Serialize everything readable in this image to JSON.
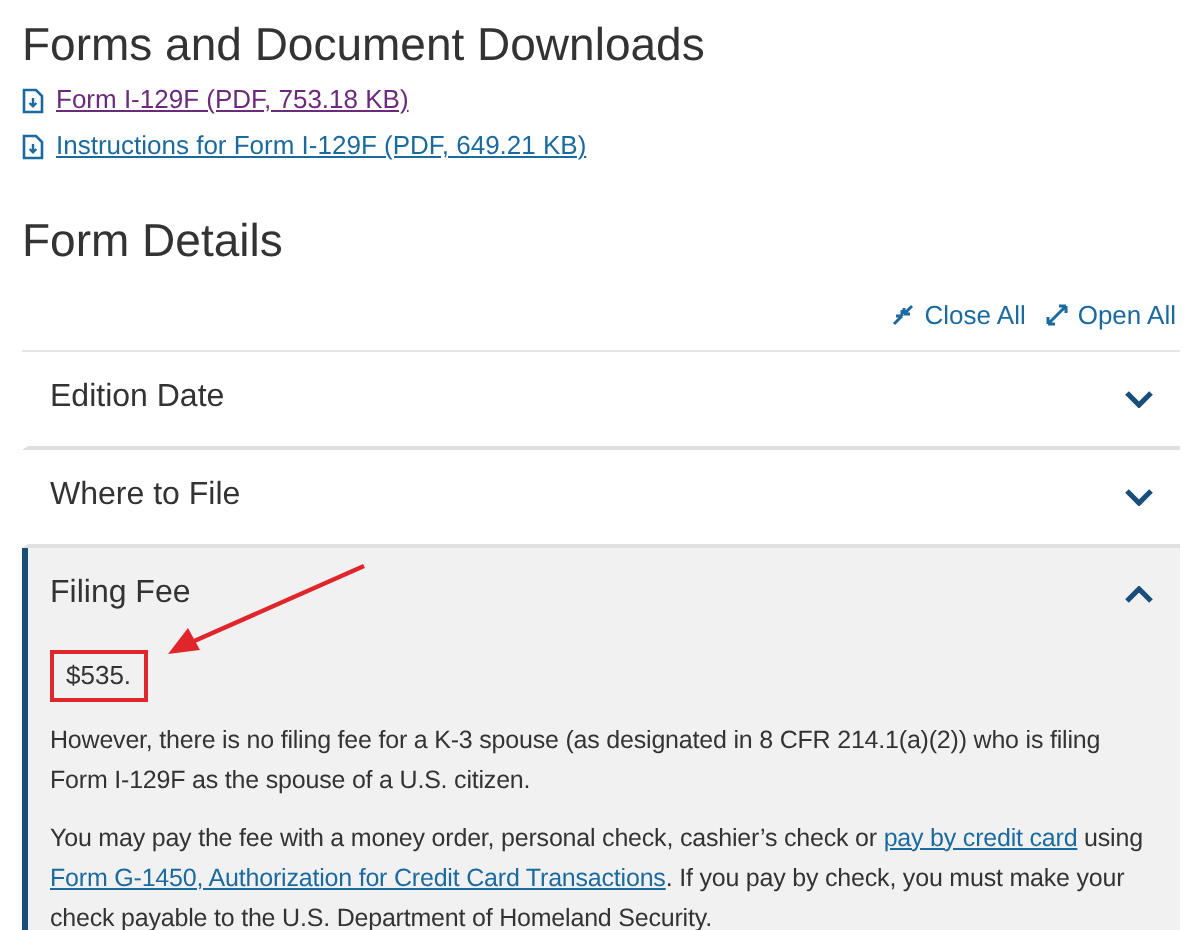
{
  "downloads": {
    "heading": "Forms and Document Downloads",
    "links": [
      {
        "label": "Form I-129F (PDF, 753.18 KB)",
        "visited": true
      },
      {
        "label": "Instructions for Form I-129F (PDF, 649.21 KB)",
        "visited": false
      }
    ]
  },
  "details": {
    "heading": "Form Details",
    "close_all": "Close All",
    "open_all": "Open All",
    "sections": [
      {
        "title": "Edition Date",
        "expanded": false
      },
      {
        "title": "Where to File",
        "expanded": false
      },
      {
        "title": "Filing Fee",
        "expanded": true,
        "fee": "$535.",
        "paragraphs": [
          [
            {
              "kind": "text",
              "text": "However, there is no filing fee for a K-3 spouse (as designated in 8 CFR 214.1(a)(2)) who is filing Form I-129F as the spouse of a U.S. citizen."
            }
          ],
          [
            {
              "kind": "text",
              "text": "You may pay the fee with a money order, personal check, cashier’s check or "
            },
            {
              "kind": "link",
              "text": "pay by credit card"
            },
            {
              "kind": "text",
              "text": " using "
            },
            {
              "kind": "link",
              "text": "Form G-1450, Authorization for Credit Card Transactions"
            },
            {
              "kind": "text",
              "text": ". If you pay by check, you must make your check payable to the U.S. Department of Homeland Security."
            }
          ]
        ]
      }
    ]
  }
}
